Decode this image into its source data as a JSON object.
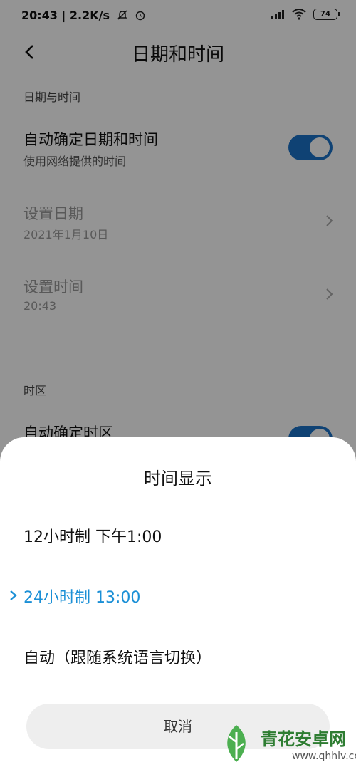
{
  "status_bar": {
    "time_speed": "20:43 | 2.2K/s",
    "battery": "74"
  },
  "header": {
    "title": "日期和时间"
  },
  "sections": {
    "date_time": {
      "label": "日期与时间",
      "auto_title": "自动确定日期和时间",
      "auto_sub": "使用网络提供的时间",
      "auto_enabled": true,
      "set_date_title": "设置日期",
      "set_date_value": "2021年1月10日",
      "set_time_title": "设置时间",
      "set_time_value": "20:43"
    },
    "timezone": {
      "label": "时区",
      "auto_title": "自动确定时区",
      "auto_enabled": true
    }
  },
  "sheet": {
    "title": "时间显示",
    "options": [
      {
        "label": "12小时制 下午1:00",
        "selected": false
      },
      {
        "label": "24小时制 13:00",
        "selected": true
      },
      {
        "label": "自动（跟随系统语言切换）",
        "selected": false
      }
    ],
    "cancel_label": "取消"
  },
  "watermark": {
    "text": "青花安卓网",
    "url": "www.qhhlv.com"
  },
  "colors": {
    "accent": "#1a73c9",
    "selected": "#1a8fd6",
    "overlay": "rgba(0,0,0,0.42)",
    "watermark": "#2e7d32"
  }
}
